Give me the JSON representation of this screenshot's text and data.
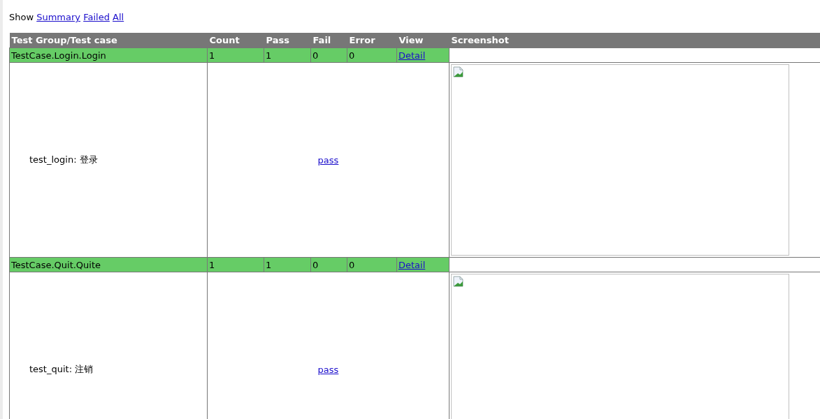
{
  "filter": {
    "label": "Show",
    "links": [
      "Summary",
      "Failed",
      "All"
    ]
  },
  "table": {
    "columns": [
      "Test Group/Test case",
      "Count",
      "Pass",
      "Fail",
      "Error",
      "View",
      "Screenshot"
    ],
    "groups": [
      {
        "name": "TestCase.Login.Login",
        "kind": "passed",
        "count": "1",
        "pass": "1",
        "fail": "0",
        "error": "0",
        "view": "Detail",
        "tests": [
          {
            "name": "test_login: 登录",
            "result": "pass"
          }
        ]
      },
      {
        "name": "TestCase.Quit.Quite",
        "kind": "passed",
        "count": "1",
        "pass": "1",
        "fail": "0",
        "error": "0",
        "view": "Detail",
        "tests": [
          {
            "name": "test_quit: 注销",
            "result": "pass"
          }
        ]
      }
    ]
  }
}
